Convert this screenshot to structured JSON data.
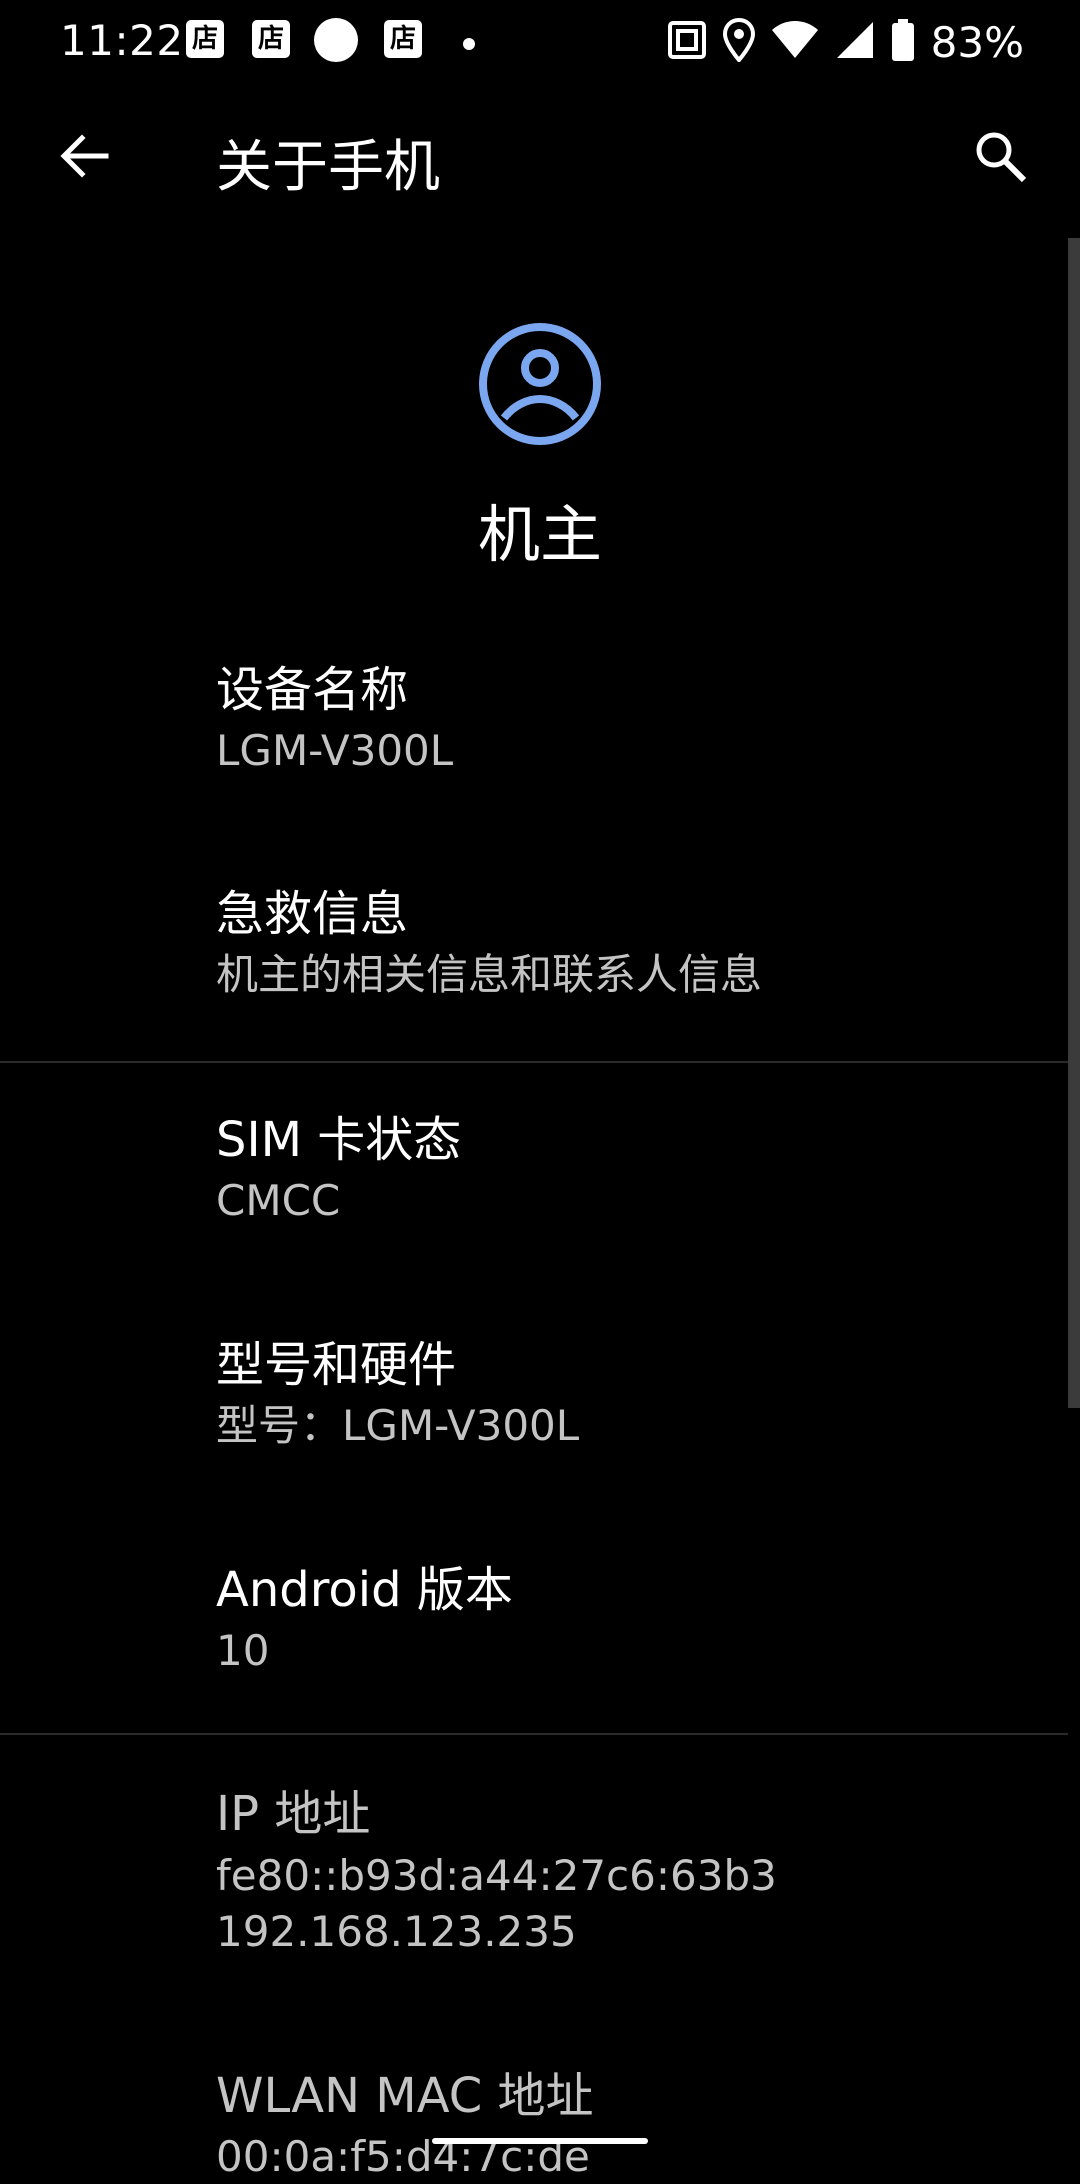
{
  "status_bar": {
    "time": "11:22",
    "notification_icons": [
      "店",
      "店",
      "店"
    ],
    "battery_percent": "83%"
  },
  "app_bar": {
    "title": "关于手机"
  },
  "profile": {
    "name": "机主",
    "avatar_color": "#7BA7F0"
  },
  "items": [
    {
      "title": "设备名称",
      "subtitle": "LGM-V300L"
    },
    {
      "title": "急救信息",
      "subtitle": "机主的相关信息和联系人信息"
    },
    {
      "title": "SIM 卡状态",
      "subtitle": "CMCC"
    },
    {
      "title": "型号和硬件",
      "subtitle": "型号：LGM-V300L"
    },
    {
      "title": "Android 版本",
      "subtitle": "10"
    },
    {
      "title": "IP 地址",
      "subtitle_lines": [
        "fe80::b93d:a44:27c6:63b3",
        "192.168.123.235"
      ]
    },
    {
      "title": "WLAN MAC 地址",
      "subtitle": "00:0a:f5:d4:7c:de"
    }
  ]
}
